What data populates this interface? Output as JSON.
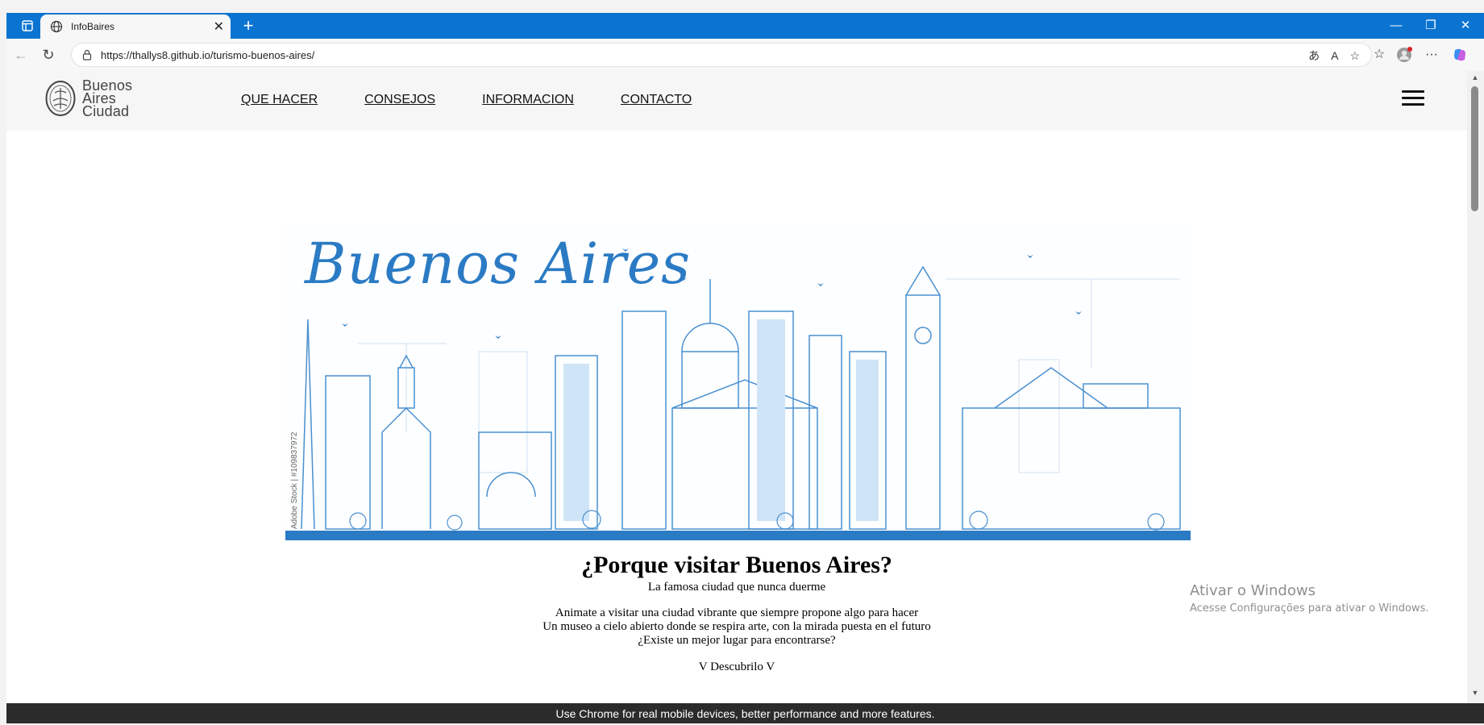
{
  "browser": {
    "tab_title": "InfoBaires",
    "url": "https://thallys8.github.io/turismo-buenos-aires/",
    "new_tab_symbol": "+",
    "tab_close_symbol": "✕",
    "window_controls": {
      "minimize": "—",
      "restore": "❐",
      "close": "✕"
    },
    "accent_color": "#0b74d1"
  },
  "site": {
    "logo": {
      "line1": "Buenos",
      "line2": "Aires",
      "line3": "Ciudad"
    },
    "nav": [
      "QUE HACER",
      "CONSEJOS",
      "INFORMACION",
      "CONTACTO"
    ],
    "hero": {
      "script_title": "Buenos Aires",
      "stock_credit": "Adobe Stock | #109837972",
      "skyline_color": "#2b7bc4"
    },
    "heading": "¿Porque visitar Buenos Aires?",
    "subheading": "La famosa ciudad que nunca duerme",
    "paragraph_lines": [
      "Animate a visitar una ciudad vibrante que siempre propone algo para hacer",
      "Un museo a cielo abierto donde se respira arte, con la mirada puesta en el futuro",
      "¿Existe un mejor lugar para encontrarse?"
    ],
    "cta": "V Descubrilo V"
  },
  "os_watermark": {
    "line1": "Ativar o Windows",
    "line2": "Acesse Configurações para ativar o Windows."
  },
  "bottom_banner": "Use Chrome for real mobile devices, better performance and more features."
}
